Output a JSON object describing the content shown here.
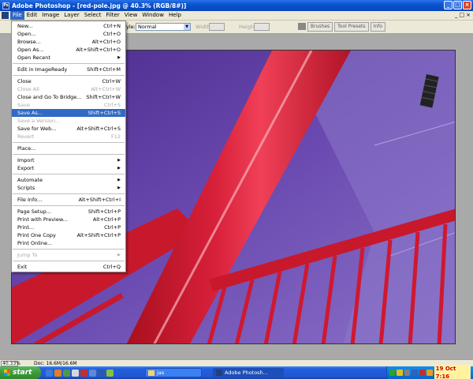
{
  "window": {
    "title": "Adobe Photoshop - [red-pole.jpg @ 40.3% (RGB/8#)]",
    "icon": "photoshop-icon",
    "controls": [
      "_",
      "□",
      "×"
    ]
  },
  "menubar": {
    "items": [
      "File",
      "Edit",
      "Image",
      "Layer",
      "Select",
      "Filter",
      "View",
      "Window",
      "Help"
    ],
    "active": "File",
    "doc_controls": [
      "_",
      "□",
      "×"
    ]
  },
  "options": {
    "style_label": "yle:",
    "style_value": "Normal",
    "width_label": "Width:",
    "height_label": "Height:",
    "palette_tabs": [
      "Brushes",
      "Tool Presets",
      "Info"
    ]
  },
  "file_menu": [
    {
      "label": "New...",
      "shortcut": "Ctrl+N"
    },
    {
      "label": "Open...",
      "shortcut": "Ctrl+O"
    },
    {
      "label": "Browse...",
      "shortcut": "Alt+Ctrl+O"
    },
    {
      "label": "Open As...",
      "shortcut": "Alt+Shift+Ctrl+O"
    },
    {
      "label": "Open Recent",
      "submenu": true
    },
    {
      "separator": true
    },
    {
      "label": "Edit in ImageReady",
      "shortcut": "Shift+Ctrl+M"
    },
    {
      "separator": true
    },
    {
      "label": "Close",
      "shortcut": "Ctrl+W"
    },
    {
      "label": "Close All",
      "shortcut": "Alt+Ctrl+W",
      "disabled": true
    },
    {
      "label": "Close and Go To Bridge...",
      "shortcut": "Shift+Ctrl+W"
    },
    {
      "label": "Save",
      "shortcut": "Ctrl+S",
      "disabled": true
    },
    {
      "label": "Save As...",
      "shortcut": "Shift+Ctrl+S",
      "highlight": true
    },
    {
      "label": "Save a Version...",
      "disabled": true
    },
    {
      "label": "Save for Web...",
      "shortcut": "Alt+Shift+Ctrl+S"
    },
    {
      "label": "Revert",
      "shortcut": "F12",
      "disabled": true
    },
    {
      "separator": true
    },
    {
      "label": "Place..."
    },
    {
      "separator": true
    },
    {
      "label": "Import",
      "submenu": true
    },
    {
      "label": "Export",
      "submenu": true
    },
    {
      "separator": true
    },
    {
      "label": "Automate",
      "submenu": true
    },
    {
      "label": "Scripts",
      "submenu": true
    },
    {
      "separator": true
    },
    {
      "label": "File Info...",
      "shortcut": "Alt+Shift+Ctrl+I"
    },
    {
      "separator": true
    },
    {
      "label": "Page Setup...",
      "shortcut": "Shift+Ctrl+P"
    },
    {
      "label": "Print with Preview...",
      "shortcut": "Alt+Ctrl+P"
    },
    {
      "label": "Print...",
      "shortcut": "Ctrl+P"
    },
    {
      "label": "Print One Copy",
      "shortcut": "Alt+Shift+Ctrl+P"
    },
    {
      "label": "Print Online..."
    },
    {
      "separator": true
    },
    {
      "label": "Jump To",
      "submenu": true,
      "disabled": true
    },
    {
      "separator": true
    },
    {
      "label": "Exit",
      "shortcut": "Ctrl+Q"
    }
  ],
  "status": {
    "zoom": "40.33%",
    "doc": "Doc: 16.6M/16.6M"
  },
  "taskbar": {
    "start_label": "start",
    "tasks": [
      {
        "label": "jas",
        "icon": "folder-icon"
      },
      {
        "label": "Adobe Photosh...",
        "icon": "photoshop-icon"
      }
    ],
    "clock": "19 Oct 7:16"
  },
  "colors": {
    "menu_highlight": "#316ac5",
    "pole_red": "#d01830",
    "wall_purple": "#6a4ab0"
  }
}
